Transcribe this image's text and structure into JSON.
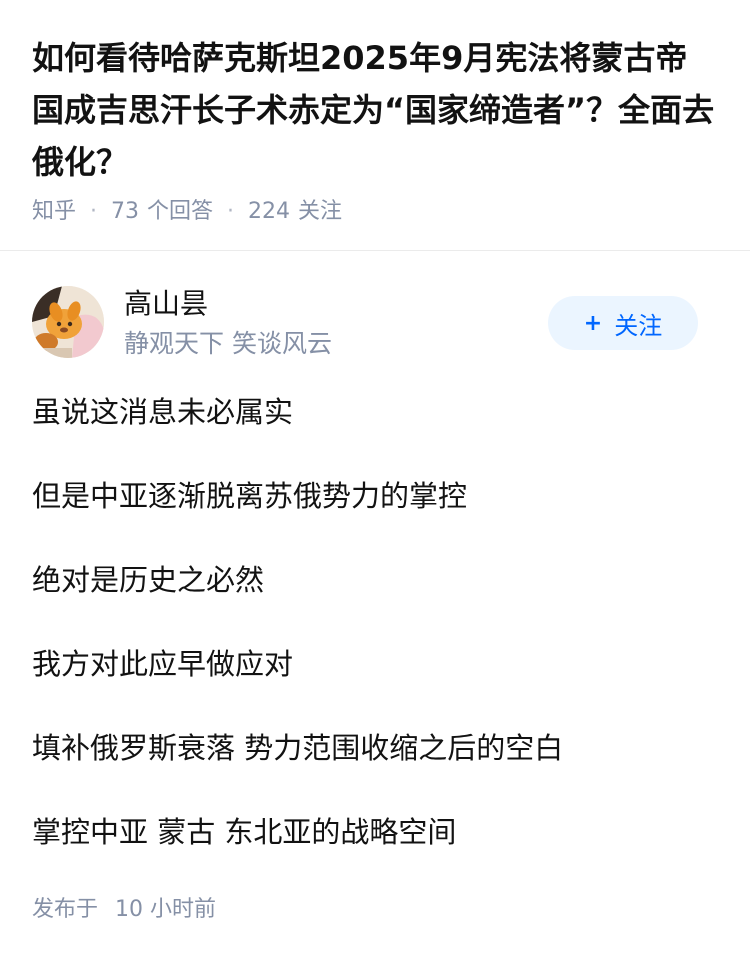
{
  "question": {
    "title": "如何看待哈萨克斯坦2025年9月宪法将蒙古帝国成吉思汗长子术赤定为“国家缔造者”？全面去俄化？",
    "source": "知乎",
    "answers_count": "73",
    "answers_label": "个回答",
    "followers_count": "224",
    "followers_label": "关注"
  },
  "author": {
    "name": "高山昙",
    "bio": "静观天下 笑谈风云",
    "follow_label": "关注",
    "follow_icon": "plus-icon"
  },
  "answer": {
    "paragraphs": [
      "虽说这消息未必属实",
      "但是中亚逐渐脱离苏俄势力的掌控",
      "绝对是历史之必然",
      "我方对此应早做应对",
      "填补俄罗斯衰落 势力范围收缩之后的空白",
      "掌控中亚 蒙古 东北亚的战略空间"
    ],
    "published_prefix": "发布于",
    "published_time": "10 小时前"
  },
  "colors": {
    "accent": "#0066ff",
    "follow_bg": "#ebf5ff",
    "meta_gray": "#8590a6",
    "text": "#121212"
  }
}
